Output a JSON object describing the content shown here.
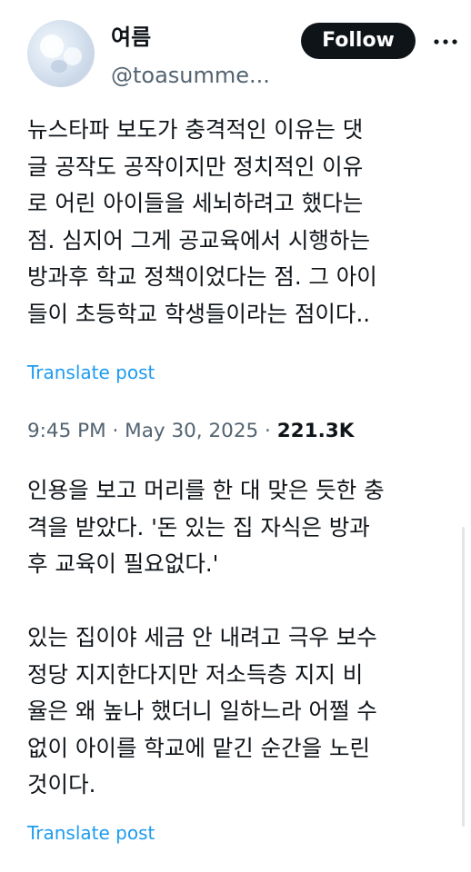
{
  "author": {
    "display_name": "여름",
    "handle": "@toasumme..."
  },
  "actions": {
    "follow_label": "Follow",
    "more_icon": "more-horizontal-icon"
  },
  "tweet": {
    "lines": [
      "뉴스타파 보도가 충격적인 이유는 댓",
      "글 공작도 공작이지만 정치적인 이유",
      "로 어린 아이들을 세뇌하려고 했다는",
      "점. 심지어 그게 공교육에서 시행하는",
      "방과후 학교 정책이었다는 점. 그 아이",
      "들이 초등학교 학생들이라는 점이다.."
    ],
    "translate_label": "Translate post"
  },
  "meta": {
    "time": "9:45 PM",
    "date": "May 30, 2025",
    "views": "221.3K"
  },
  "reply": {
    "lines_1": [
      "인용을 보고 머리를 한 대 맞은 듯한 충",
      "격을 받았다. '돈 있는 집 자식은 방과",
      "후 교육이 필요없다.'"
    ],
    "lines_2": [
      "있는 집이야 세금 안 내려고 극우 보수",
      "정당 지지한다지만 저소득층 지지 비",
      "율은 왜 높나 했더니 일하느라 어쩔 수",
      "없이 아이를 학교에 맡긴 순간을 노린",
      "것이다."
    ],
    "translate_label": "Translate post"
  },
  "colors": {
    "text": "#0f1419",
    "secondary": "#536471",
    "link": "#1d9bf0",
    "button_bg": "#0f1419",
    "button_text": "#ffffff"
  }
}
